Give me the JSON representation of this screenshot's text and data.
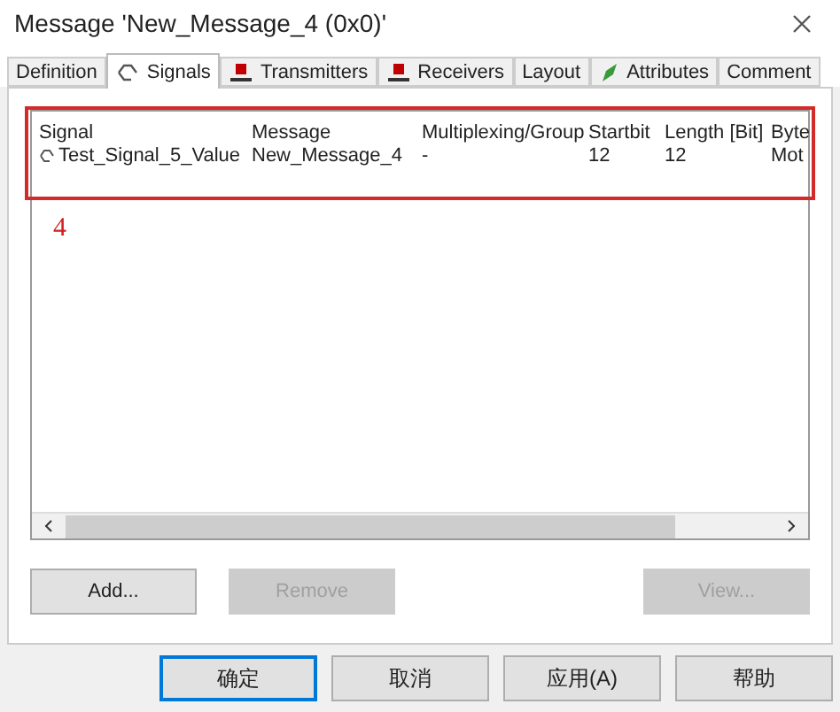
{
  "window": {
    "title": "Message 'New_Message_4 (0x0)'"
  },
  "tabs": [
    {
      "label": "Definition",
      "selected": false,
      "kind": "plain"
    },
    {
      "label": "Signals",
      "selected": true,
      "kind": "signal"
    },
    {
      "label": "Transmitters",
      "selected": false,
      "kind": "node"
    },
    {
      "label": "Receivers",
      "selected": false,
      "kind": "node"
    },
    {
      "label": "Layout",
      "selected": false,
      "kind": "plain"
    },
    {
      "label": "Attributes",
      "selected": false,
      "kind": "pen"
    },
    {
      "label": "Comment",
      "selected": false,
      "kind": "plain"
    }
  ],
  "table": {
    "columns": [
      "Signal",
      "Message",
      "Multiplexing/Group",
      "Startbit",
      "Length [Bit]",
      "Byte"
    ],
    "rows": [
      {
        "cells": [
          "Test_Signal_5_Value",
          "New_Message_4",
          "-",
          "12",
          "12",
          "Mot"
        ]
      }
    ]
  },
  "annotation": {
    "label": "4"
  },
  "panel_buttons": [
    {
      "label": "Add...",
      "disabled": false
    },
    {
      "label": "Remove",
      "disabled": true
    },
    {
      "label": "View...",
      "disabled": true
    }
  ],
  "dialog_buttons": [
    {
      "label": "确定",
      "default": true
    },
    {
      "label": "取消",
      "default": false
    },
    {
      "label": "应用(A)",
      "default": false
    },
    {
      "label": "帮助",
      "default": false
    }
  ]
}
